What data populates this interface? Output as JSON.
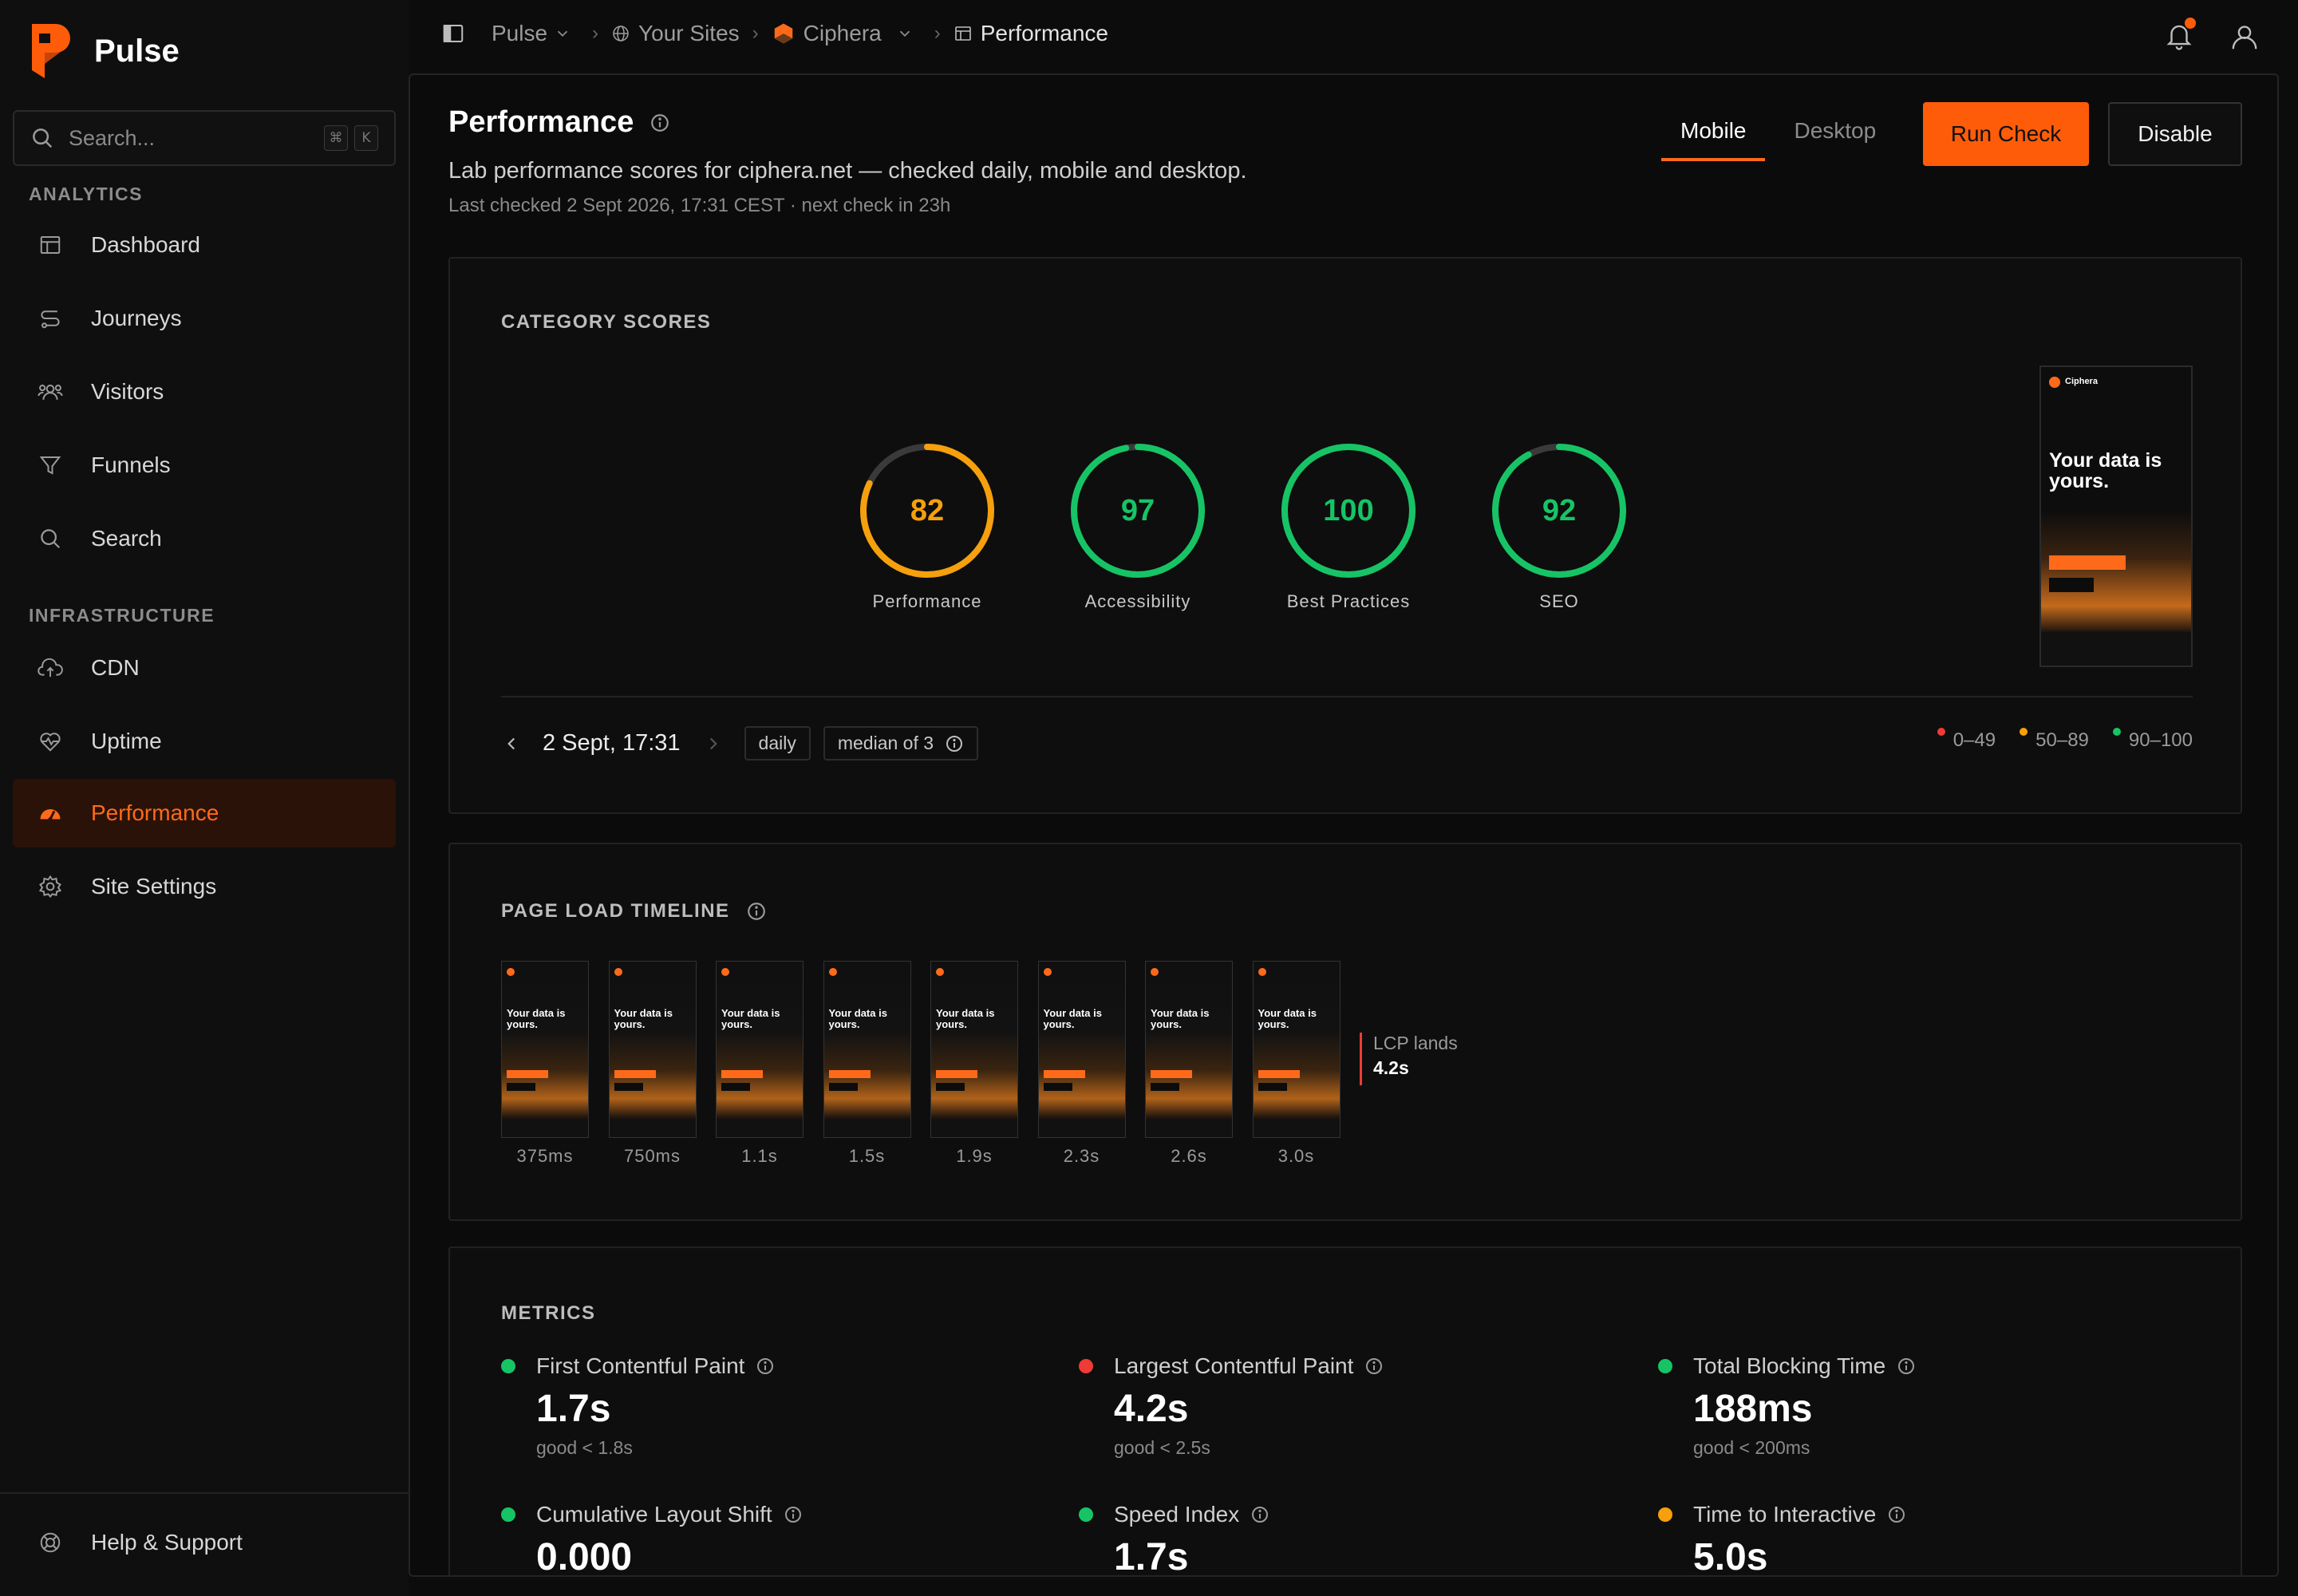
{
  "brand": {
    "name": "Pulse",
    "accent": "#ff6a1a"
  },
  "search": {
    "placeholder": "Search...",
    "kbd1": "⌘",
    "kbd2": "K"
  },
  "sidebar": {
    "analytics_label": "ANALYTICS",
    "infrastructure_label": "INFRASTRUCTURE",
    "items": [
      {
        "label": "Dashboard",
        "icon": "dashboard-icon"
      },
      {
        "label": "Journeys",
        "icon": "route-icon"
      },
      {
        "label": "Visitors",
        "icon": "users-icon"
      },
      {
        "label": "Funnels",
        "icon": "funnel-icon"
      },
      {
        "label": "Search",
        "icon": "search-icon"
      },
      {
        "label": "CDN",
        "icon": "cloud-icon"
      },
      {
        "label": "Uptime",
        "icon": "heart-pulse-icon"
      },
      {
        "label": "Performance",
        "icon": "gauge-icon",
        "active": true
      },
      {
        "label": "Site Settings",
        "icon": "gear-icon"
      }
    ],
    "footer": {
      "label": "Help & Support"
    }
  },
  "breadcrumb": {
    "items": [
      "Pulse",
      "Your Sites",
      "Ciphera",
      "Performance"
    ]
  },
  "page": {
    "title": "Performance",
    "description": "Lab performance scores for ciphera.net — checked daily, mobile and desktop.",
    "meta": "Last checked 2 Sept 2026, 17:31 CEST  ·  next check in 23h",
    "tabs": [
      "Mobile",
      "Desktop"
    ],
    "active_tab": "Mobile",
    "run_button": "Run Check",
    "disable_button": "Disable"
  },
  "scores": {
    "title": "CATEGORY SCORES",
    "items": [
      {
        "label": "Performance",
        "value": 82,
        "color": "#f5a00c"
      },
      {
        "label": "Accessibility",
        "value": 97,
        "color": "#16c466"
      },
      {
        "label": "Best Practices",
        "value": 100,
        "color": "#16c466"
      },
      {
        "label": "SEO",
        "value": 92,
        "color": "#16c466"
      }
    ],
    "date": "2 Sept, 17:31",
    "frequency": "daily",
    "median": "median of 3",
    "legend": [
      {
        "label": "0–49",
        "color": "#ef3b36"
      },
      {
        "label": "50–89",
        "color": "#f5a00c"
      },
      {
        "label": "90–100",
        "color": "#16c466"
      }
    ],
    "preview": {
      "brand": "Ciphera",
      "headline": "Your data is yours."
    }
  },
  "timeline": {
    "title": "PAGE LOAD TIMELINE",
    "frames": [
      "375ms",
      "750ms",
      "1.1s",
      "1.5s",
      "1.9s",
      "2.3s",
      "2.6s",
      "3.0s"
    ],
    "frame_headline": "Your data is yours.",
    "lcp_label": "LCP lands",
    "lcp_value": "4.2s"
  },
  "metrics": {
    "title": "METRICS",
    "items": [
      {
        "label": "First Contentful Paint",
        "value": "1.7s",
        "threshold": "good < 1.8s",
        "color": "#16c466"
      },
      {
        "label": "Largest Contentful Paint",
        "value": "4.2s",
        "threshold": "good < 2.5s",
        "color": "#ef3b36"
      },
      {
        "label": "Total Blocking Time",
        "value": "188ms",
        "threshold": "good < 200ms",
        "color": "#16c466"
      },
      {
        "label": "Cumulative Layout Shift",
        "value": "0.000",
        "threshold": "",
        "color": "#16c466"
      },
      {
        "label": "Speed Index",
        "value": "1.7s",
        "threshold": "",
        "color": "#16c466"
      },
      {
        "label": "Time to Interactive",
        "value": "5.0s",
        "threshold": "",
        "color": "#f5a00c"
      }
    ]
  }
}
